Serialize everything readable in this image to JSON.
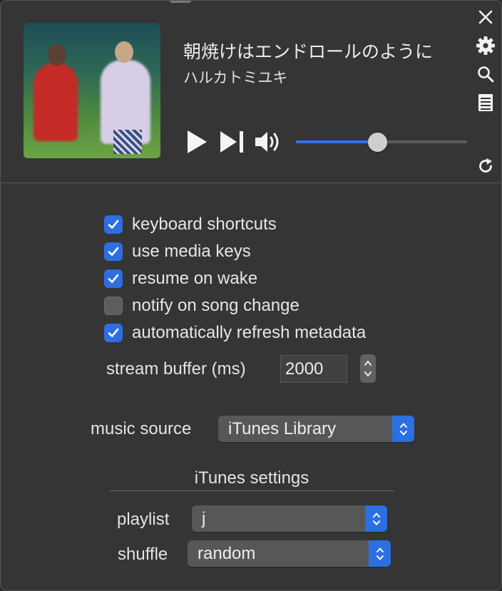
{
  "player": {
    "song_title": "朝焼けはエンドロールのように",
    "artist": "ハルカトミユキ",
    "volume_fraction": 0.48,
    "album_art_icon": "album-art-image",
    "controls": {
      "play_icon": "play-icon",
      "next_icon": "skip-next-icon",
      "volume_icon": "speaker-volume-icon"
    },
    "side_icons": [
      "close-icon",
      "gear-icon",
      "search-icon",
      "list-icon",
      "refresh-icon"
    ]
  },
  "settings": {
    "checkboxes": [
      {
        "label": "keyboard shortcuts",
        "checked": true
      },
      {
        "label": "use media keys",
        "checked": true
      },
      {
        "label": "resume on wake",
        "checked": true
      },
      {
        "label": "notify on song change",
        "checked": false
      },
      {
        "label": "automatically refresh metadata",
        "checked": true
      }
    ],
    "stream_buffer": {
      "label": "stream buffer (ms)",
      "value": "2000"
    },
    "music_source": {
      "label": "music source",
      "value": "iTunes Library"
    },
    "itunes": {
      "section_title": "iTunes settings",
      "playlist": {
        "label": "playlist",
        "value": "j"
      },
      "shuffle": {
        "label": "shuffle",
        "value": "random"
      }
    }
  },
  "colors": {
    "accent": "#2d6fe0",
    "background": "#353535",
    "text": "#e6e6e6"
  }
}
